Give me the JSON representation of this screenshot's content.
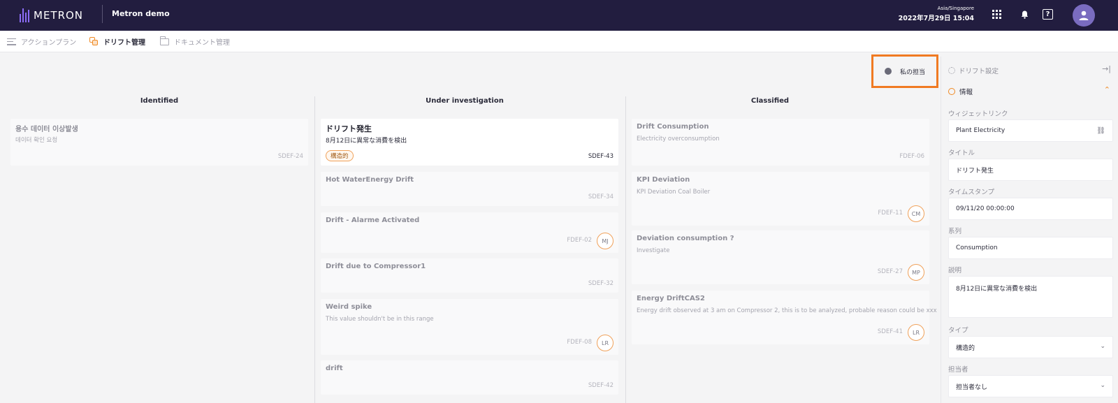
{
  "topbar": {
    "logo_text": "METRON",
    "app_name": "Metron demo",
    "timezone": "Asia/Singapore",
    "datetime": "2022年7月29日 15:04",
    "help_label": "?"
  },
  "subnav": {
    "items": [
      {
        "label": "アクションプラン",
        "icon": "menu-icon",
        "active": false
      },
      {
        "label": "ドリフト管理",
        "icon": "drift-icon",
        "active": true
      },
      {
        "label": "ドキュメント管理",
        "icon": "folder-icon",
        "active": false
      }
    ]
  },
  "filter": {
    "label": "私の担当"
  },
  "columns": [
    {
      "title": "Identified",
      "cards": [
        {
          "title": "용수 데이터 이상발생",
          "desc": "데이터 확인 요청",
          "id": "SDEF-24"
        }
      ]
    },
    {
      "title": "Under investigation",
      "cards": [
        {
          "title": "ドリフト発生",
          "desc": "8月12日に異常な消費を検出",
          "id": "SDEF-43",
          "tag": "構造的",
          "active": true
        },
        {
          "title": "Hot WaterEnergy Drift",
          "desc": "",
          "id": "SDEF-34"
        },
        {
          "title": "Drift - Alarme Activated",
          "desc": "",
          "id": "FDEF-02",
          "avatar": "MJ"
        },
        {
          "title": "Drift due to Compressor1",
          "desc": "",
          "id": "SDEF-32"
        },
        {
          "title": "Weird spike",
          "desc": "This value shouldn't be in this range",
          "id": "FDEF-08",
          "avatar": "LR"
        },
        {
          "title": "drift",
          "desc": "",
          "id": "SDEF-42"
        }
      ]
    },
    {
      "title": "Classified",
      "cards": [
        {
          "title": "Drift Consumption",
          "desc": "Electricity overconsumption",
          "id": "FDEF-06"
        },
        {
          "title": "KPI Deviation",
          "desc": "KPI Deviation Coal Boiler",
          "id": "FDEF-11",
          "avatar": "CM"
        },
        {
          "title": "Deviation consumption ?",
          "desc": "Investigate",
          "id": "SDEF-27",
          "avatar": "MP"
        },
        {
          "title": "Energy DriftCAS2",
          "desc": "Energy drift observed at 3 am on Compressor 2, this is to be analyzed, probable reason could be xxx",
          "id": "SDEF-41",
          "avatar": "LR"
        }
      ]
    }
  ],
  "panel": {
    "title": "ドリフト設定",
    "collapse_icon": "→|",
    "section": "情報",
    "fields": {
      "widget_link": {
        "label": "ウィジェットリンク",
        "value": "Plant Electricity"
      },
      "title": {
        "label": "タイトル",
        "value": "ドリフト発生"
      },
      "timestamp": {
        "label": "タイムスタンプ",
        "value": "09/11/20 00:00:00"
      },
      "series": {
        "label": "系列",
        "value": "Consumption"
      },
      "description": {
        "label": "説明",
        "value": "8月12日に異常な消費を検出"
      },
      "type": {
        "label": "タイプ",
        "value": "構造的"
      },
      "assignee": {
        "label": "担当者",
        "value": "担当者なし"
      }
    }
  },
  "colors": {
    "topbar_bg": "#221d3f",
    "accent": "#f08a24",
    "highlight_border": "#f07a22",
    "avatar_bg": "#7a6cc0"
  }
}
